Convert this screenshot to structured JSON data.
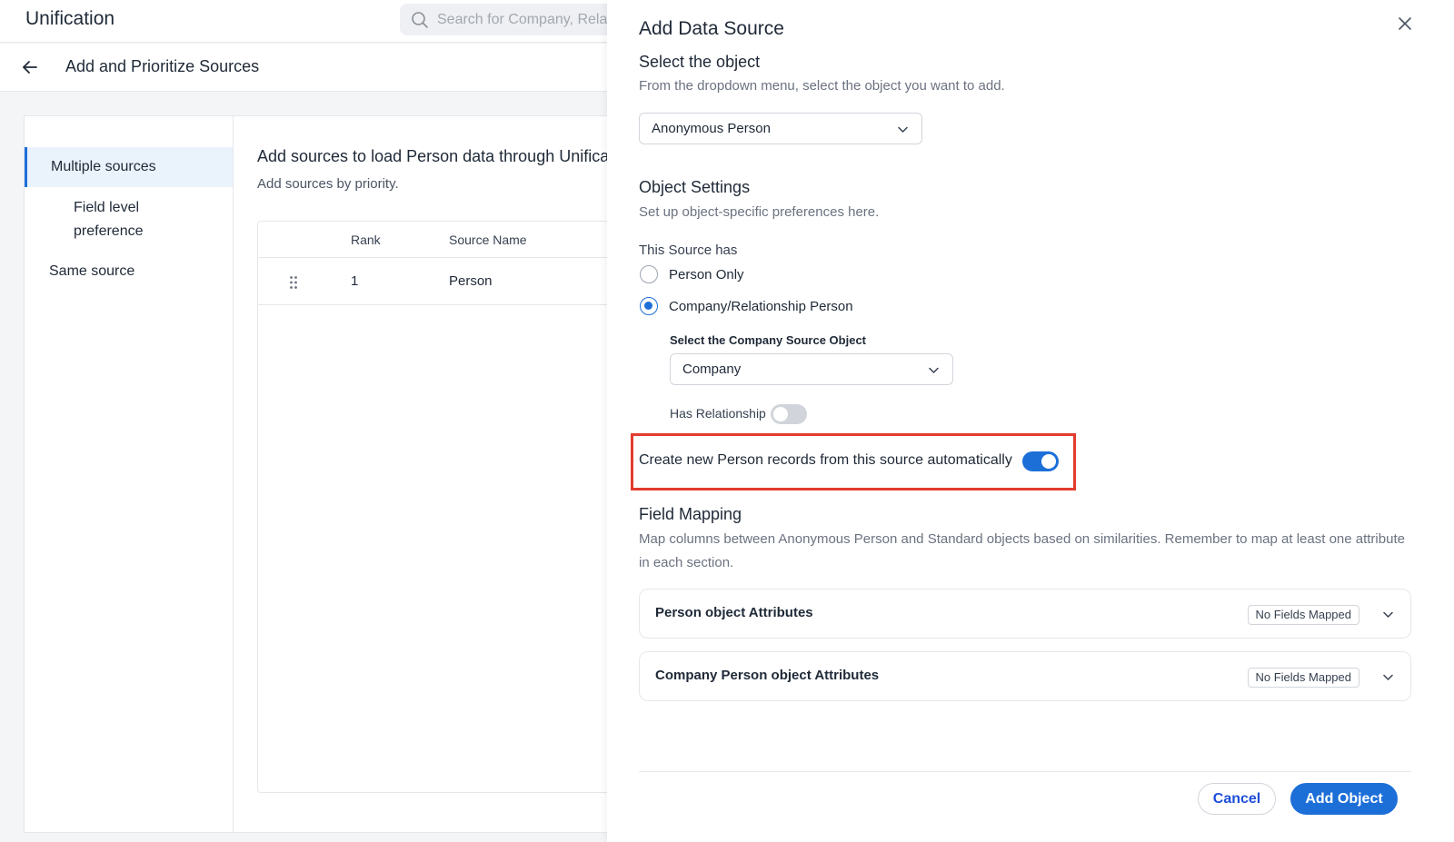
{
  "app": {
    "title": "Unification",
    "search_placeholder": "Search for Company, Relationship"
  },
  "subheader": {
    "title": "Add and Prioritize Sources"
  },
  "sidenav": {
    "items": [
      {
        "label": "Multiple sources",
        "active": true
      },
      {
        "label": "Field level preference"
      },
      {
        "label": "Same source"
      }
    ]
  },
  "content": {
    "title": "Add sources to load Person data through Unification",
    "subtitle": "Add sources by priority.",
    "table": {
      "columns": [
        "Rank",
        "Source Name"
      ],
      "rows": [
        {
          "rank": "1",
          "source_name": "Person"
        }
      ]
    }
  },
  "drawer": {
    "title": "Add Data Source",
    "select_object": {
      "title": "Select the object",
      "description": "From the dropdown menu, select the object you want to add.",
      "value": "Anonymous Person"
    },
    "object_settings": {
      "title": "Object Settings",
      "description": "Set up object-specific preferences here.",
      "source_has_label": "This Source has",
      "options": [
        {
          "label": "Person Only",
          "checked": false
        },
        {
          "label": "Company/Relationship Person",
          "checked": true
        }
      ],
      "company_source_label": "Select the Company Source Object",
      "company_source_value": "Company",
      "has_relationship_label": "Has Relationship",
      "has_relationship_on": false,
      "create_records_label": "Create new Person records from this source automatically",
      "create_records_on": true
    },
    "field_mapping": {
      "title": "Field Mapping",
      "description": "Map columns between Anonymous Person and Standard objects based on similarities. Remember to map at least one attribute in each section.",
      "sections": [
        {
          "title": "Person object Attributes",
          "badge": "No Fields Mapped"
        },
        {
          "title": "Company Person object Attributes",
          "badge": "No Fields Mapped"
        }
      ]
    },
    "buttons": {
      "cancel": "Cancel",
      "submit": "Add Object"
    }
  },
  "colors": {
    "accent": "#1d6fd8",
    "highlight": "#e23b2e",
    "active_nav_bg": "#eaf2fc"
  }
}
